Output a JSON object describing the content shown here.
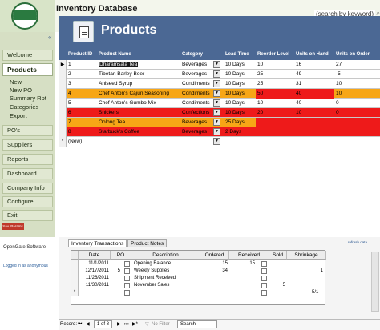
{
  "app": {
    "title": "Inventory Database",
    "search_placeholder": "(search by keyword)"
  },
  "sidebar": {
    "collapse_glyph": "«",
    "items": [
      {
        "label": "Welcome"
      },
      {
        "label": "Products"
      },
      {
        "label": "PO's"
      },
      {
        "label": "Suppliers"
      },
      {
        "label": "Reports"
      },
      {
        "label": "Dashboard"
      },
      {
        "label": "Company Info"
      },
      {
        "label": "Configure"
      },
      {
        "label": "Exit"
      }
    ],
    "sub_items": [
      {
        "label": "New"
      },
      {
        "label": "New PO"
      },
      {
        "label": "Summary Rpt"
      },
      {
        "label": "Categories"
      },
      {
        "label": "Export"
      }
    ],
    "status_pill": "Sav. Params",
    "company": "OpenGate Software",
    "logged_in": "Logged in as anonymous"
  },
  "panel": {
    "title": "Products",
    "columns": [
      "Product ID",
      "Product Name",
      "Category",
      "Lead Time",
      "Reorder Level",
      "Units on Hand",
      "Units on Order"
    ],
    "rows": [
      {
        "id": "1",
        "name": "Dharamsala Tea",
        "category": "Beverages",
        "lead": "10 Days",
        "reorder": "10",
        "onhand": "16",
        "onorder": "27",
        "color": "white",
        "selected": true
      },
      {
        "id": "2",
        "name": "Tibetan Barley Beer",
        "category": "Beverages",
        "lead": "10 Days",
        "reorder": "25",
        "onhand": "49",
        "onorder": "-5",
        "color": "white"
      },
      {
        "id": "3",
        "name": "Aniseed Syrup",
        "category": "Condiments",
        "lead": "10 Days",
        "reorder": "25",
        "onhand": "31",
        "onorder": "10",
        "color": "white"
      },
      {
        "id": "4",
        "name": "Chef Anton's Cajun Seasoning",
        "category": "Condiments",
        "lead": "10 Days",
        "reorder": "50",
        "onhand": "40",
        "onorder": "10",
        "color": "orange"
      },
      {
        "id": "5",
        "name": "Chef Anton's Gumbo Mix",
        "category": "Condiments",
        "lead": "10 Days",
        "reorder": "10",
        "onhand": "40",
        "onorder": "0",
        "color": "white"
      },
      {
        "id": "6",
        "name": "Snickers",
        "category": "Confections",
        "lead": "10 Days",
        "reorder": "20",
        "onhand": "10",
        "onorder": "0",
        "color": "red"
      },
      {
        "id": "7",
        "name": "Oolong Tea",
        "category": "Beverages",
        "lead": "25 Days",
        "reorder": "",
        "onhand": "",
        "onorder": "",
        "color": "orange"
      },
      {
        "id": "8",
        "name": "Starbuck's Coffee",
        "category": "Beverages",
        "lead": "2 Days",
        "reorder": "",
        "onhand": "",
        "onorder": "",
        "color": "red"
      }
    ],
    "new_row": "(New)"
  },
  "subform": {
    "tabs": [
      "Inventory Transactions",
      "Product Notes"
    ],
    "refresh": "refresh data",
    "columns": [
      "Date",
      "PO",
      "Description",
      "Ordered",
      "Received",
      "Sold",
      "Shrinkage"
    ],
    "rows": [
      {
        "date": "11/1/2011",
        "po": "",
        "desc": "Opening Balance",
        "ordered": "15",
        "received": "15",
        "sold": "",
        "shrink": "",
        "received_checkbox": true
      },
      {
        "date": "12/17/2011",
        "po": "5",
        "desc": "Weekly Supplies",
        "ordered": "34",
        "received": "",
        "sold": "",
        "shrink": "1",
        "received_checkbox": true
      },
      {
        "date": "11/26/2011",
        "po": "",
        "desc": "Shipment Received",
        "ordered": "",
        "received": "",
        "sold": "",
        "shrink": "",
        "received_checkbox": true
      },
      {
        "date": "11/30/2011",
        "po": "",
        "desc": "November Sales",
        "ordered": "",
        "received": "",
        "sold": "5",
        "shrink": "",
        "received_checkbox": true
      }
    ],
    "new_row_marker": "*",
    "trailing_value": "5/1"
  },
  "recnav": {
    "label": "Record:",
    "position": "1 of 8",
    "filter": "No Filter",
    "search": "Search"
  }
}
